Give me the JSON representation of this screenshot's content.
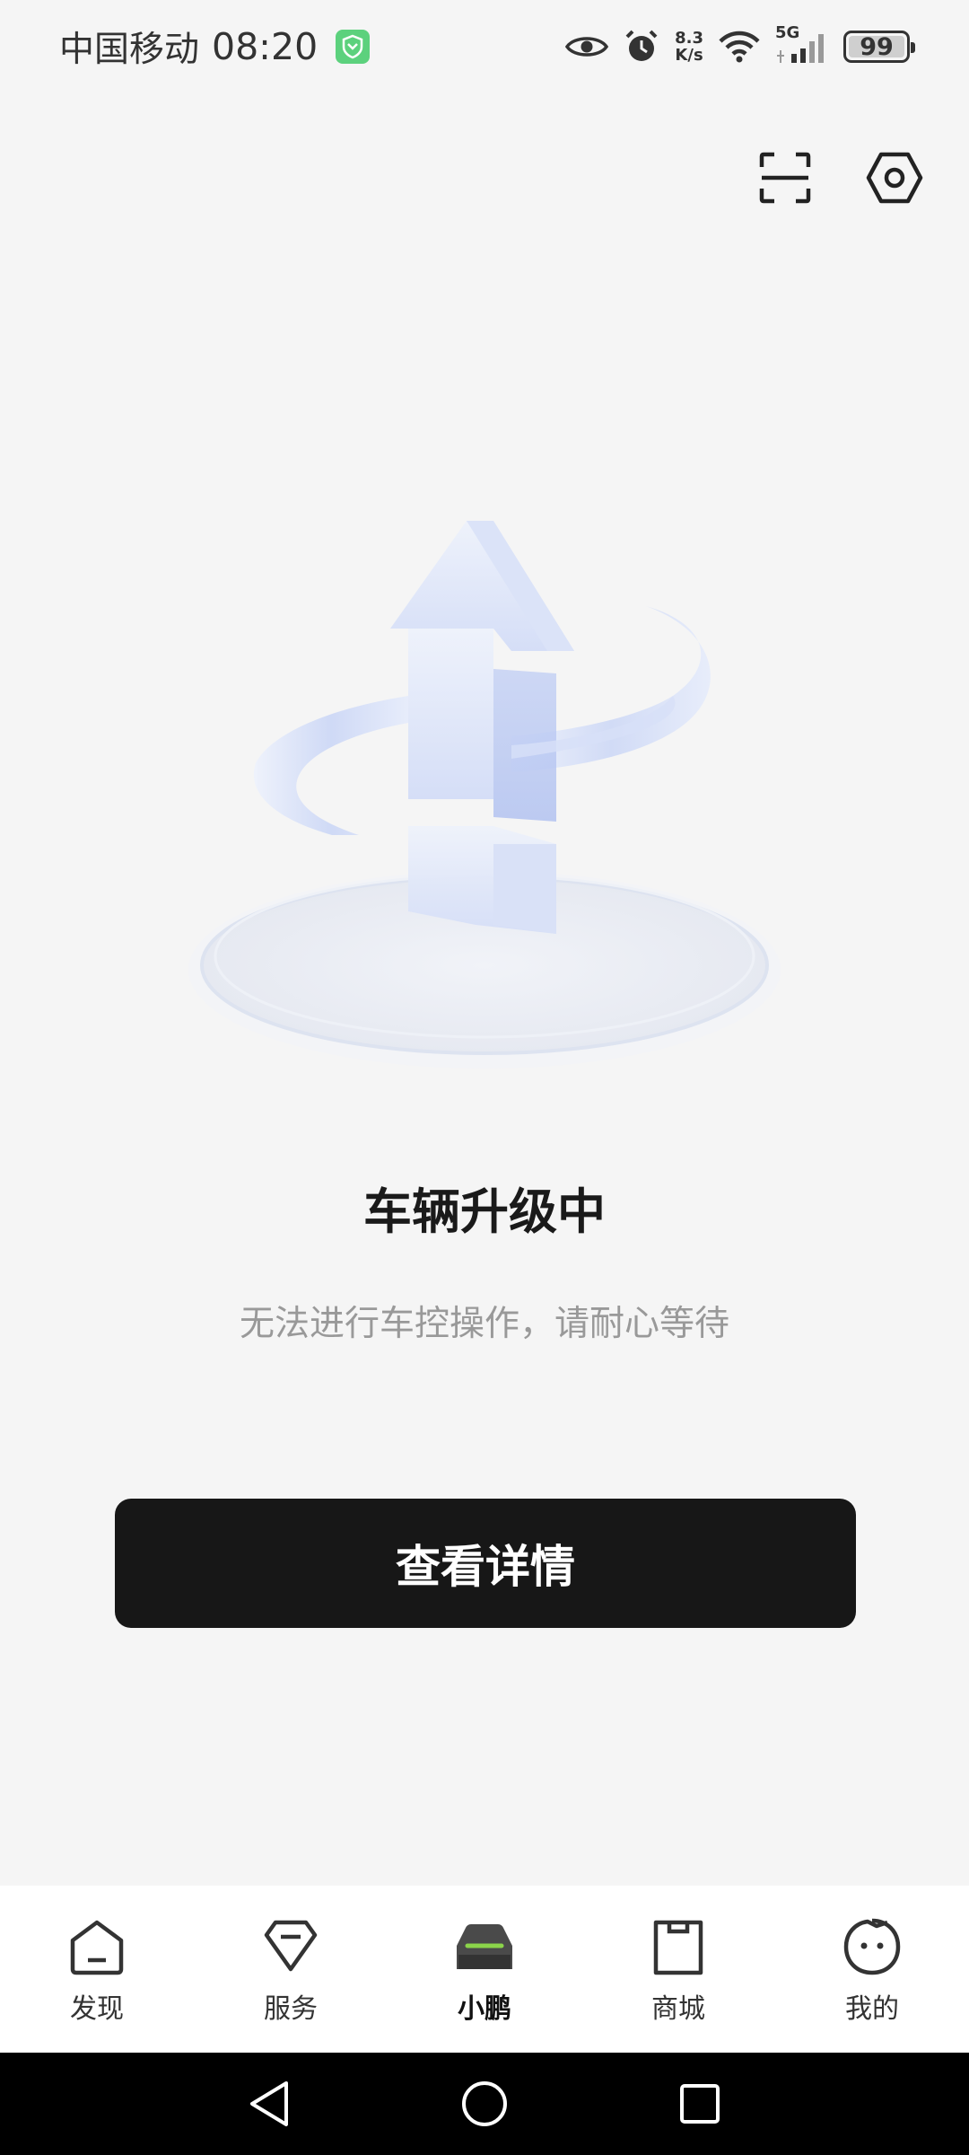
{
  "status_bar": {
    "carrier": "中国移动",
    "time": "08:20",
    "net_speed_value": "8.3",
    "net_speed_unit": "K/s",
    "network_type": "5G",
    "battery": "99",
    "icons": [
      "shield-app-icon",
      "eye-icon",
      "alarm-icon",
      "wifi-icon",
      "signal-icon",
      "battery-icon"
    ]
  },
  "header": {
    "icons": [
      "scan-icon",
      "settings-icon"
    ]
  },
  "main": {
    "title": "车辆升级中",
    "subtitle": "无法进行车控操作，请耐心等待",
    "button_label": "查看详情",
    "illustration": "upgrade-arrow-illustration"
  },
  "tabs": [
    {
      "label": "发现",
      "icon": "home-icon",
      "active": false
    },
    {
      "label": "服务",
      "icon": "service-icon",
      "active": false
    },
    {
      "label": "小鹏",
      "icon": "car-icon",
      "active": true
    },
    {
      "label": "商城",
      "icon": "shop-icon",
      "active": false
    },
    {
      "label": "我的",
      "icon": "profile-icon",
      "active": false
    }
  ],
  "nav_bar": {
    "icons": [
      "back-icon",
      "home-circle-icon",
      "recents-icon"
    ]
  },
  "colors": {
    "background": "#f5f5f5",
    "button": "#171717",
    "accent_green": "#8bd44a",
    "illustration_blue": "#c9d6f7"
  }
}
